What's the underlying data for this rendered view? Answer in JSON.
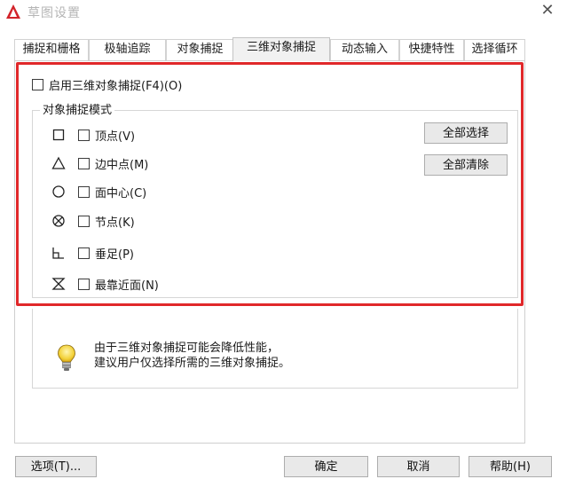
{
  "window": {
    "title": "草图设置"
  },
  "tabs": [
    {
      "label": "捕捉和栅格",
      "active": false
    },
    {
      "label": "极轴追踪",
      "active": false
    },
    {
      "label": "对象捕捉",
      "active": false
    },
    {
      "label": "三维对象捕捉",
      "active": true
    },
    {
      "label": "动态输入",
      "active": false
    },
    {
      "label": "快捷特性",
      "active": false
    },
    {
      "label": "选择循环",
      "active": false
    }
  ],
  "snap3d": {
    "enable_label": "启用三维对象捕捉(F4)(O)",
    "enable_checked": false,
    "group_title": "对象捕捉模式",
    "modes": [
      {
        "label": "顶点(V)",
        "icon": "square-marker-icon",
        "checked": false
      },
      {
        "label": "边中点(M)",
        "icon": "triangle-marker-icon",
        "checked": false
      },
      {
        "label": "面中心(C)",
        "icon": "circle-marker-icon",
        "checked": false
      },
      {
        "label": "节点(K)",
        "icon": "node-marker-icon",
        "checked": false
      },
      {
        "label": "垂足(P)",
        "icon": "perpendicular-marker-icon",
        "checked": false
      },
      {
        "label": "最靠近面(N)",
        "icon": "nearest-face-marker-icon",
        "checked": false
      }
    ],
    "select_all_label": "全部选择",
    "clear_all_label": "全部清除"
  },
  "info": {
    "icon": "lightbulb-icon",
    "line1": "由于三维对象捕捉可能会降低性能，",
    "line2": "建议用户仅选择所需的三维对象捕捉。"
  },
  "footer": {
    "options_label": "选项(T)...",
    "ok_label": "确定",
    "cancel_label": "取消",
    "help_label": "帮助(H)"
  },
  "colors": {
    "highlight_frame": "#e0282a",
    "title_text": "#b5b5b5",
    "app_icon": "#d2232a"
  }
}
